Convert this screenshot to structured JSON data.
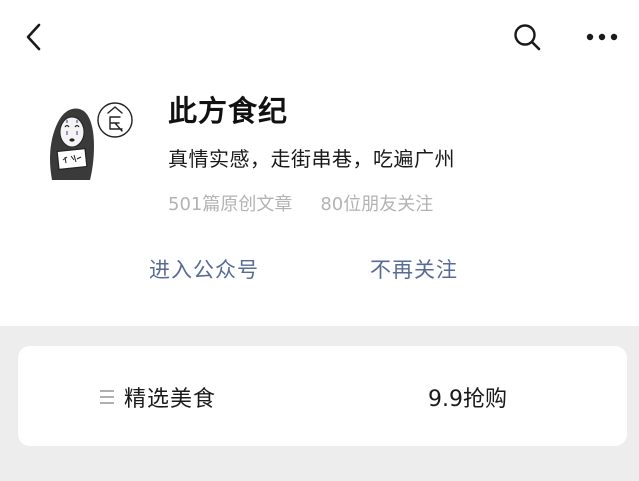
{
  "nav": {
    "back_icon": "chevron-left-icon",
    "search_icon": "search-icon",
    "more_icon": "more-dots-icon"
  },
  "account": {
    "name": "此方食纪",
    "description": "真情实感，走街串巷，吃遍广州",
    "articles": "501篇原创文章",
    "followers": "80位朋友关注"
  },
  "actions": {
    "enter": "进入公众号",
    "unfollow": "不再关注"
  },
  "menu": {
    "item1_icon": "menu-list-icon",
    "item1_label": "精选美食",
    "item2_label": "9.9抢购"
  },
  "colors": {
    "link": "#576b95",
    "text": "#1a1a1a",
    "secondary": "#b3b3b3",
    "background": "#ededed"
  }
}
